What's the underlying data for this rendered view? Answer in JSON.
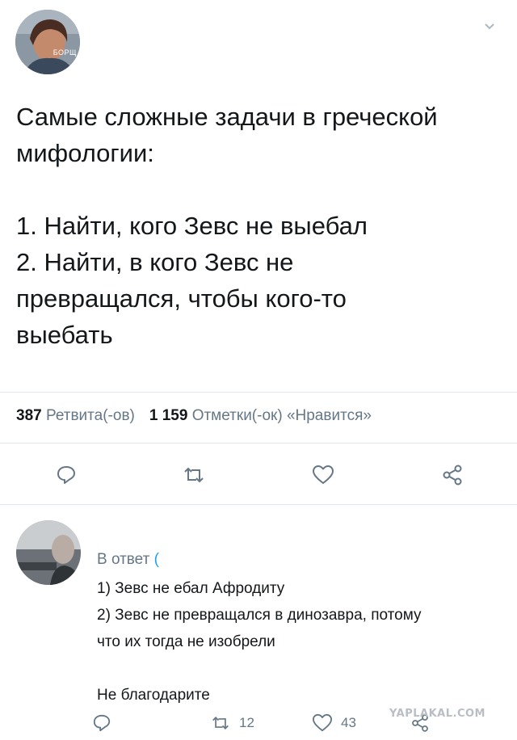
{
  "tweet": {
    "avatar_tag": "БОРЩ",
    "text": "Самые сложные задачи в греческой\nмифологии:\n\n1. Найти, кого Зевс не выебал\n2. Найти, в кого Зевс не\nпревращался, чтобы кого-то\nвыебать",
    "retweets_count": "387",
    "retweets_label": "Ретвита(-ов)",
    "likes_count": "1 159",
    "likes_label": "Отметки(-ок) «Нравится»"
  },
  "reply": {
    "reply_to_label": "В ответ",
    "reply_to_handle": "(",
    "text": "1) Зевс не ебал Афродиту\n2) Зевс не превращался в динозавра, потому\nчто их тогда не изобрели\n\nНе благодарите",
    "retweets": "12",
    "likes": "43"
  },
  "watermark": "YAPLAKAL.COM",
  "icons": [
    "chevron-down-icon",
    "reply-icon",
    "retweet-icon",
    "like-icon",
    "share-icon"
  ]
}
